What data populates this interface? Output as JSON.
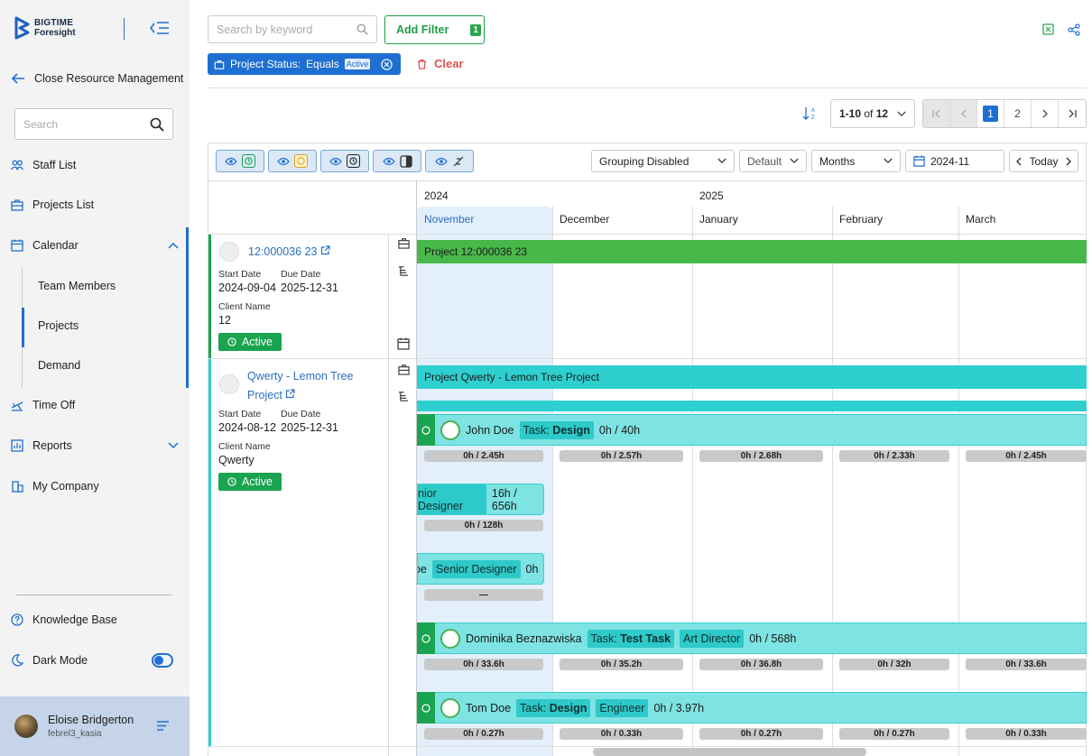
{
  "brand": {
    "line1": "BIGTIME",
    "line2": "Foresight"
  },
  "sidebar": {
    "back_label": "Close Resource Management",
    "search_placeholder": "Search",
    "items": {
      "staff": "Staff List",
      "projects": "Projects List",
      "calendar": "Calendar",
      "team": "Team Members",
      "cal_projects": "Projects",
      "demand": "Demand",
      "timeoff": "Time Off",
      "reports": "Reports",
      "company": "My Company"
    },
    "knowledge": "Knowledge Base",
    "dark_mode": "Dark Mode",
    "user": {
      "name": "Eloise Bridgerton",
      "handle": "febrel3_kasia"
    }
  },
  "toolbar": {
    "search_placeholder": "Search by keyword",
    "add_filter": "Add Filter",
    "filter_count": "1",
    "chip": {
      "field": "Project Status:",
      "op": "Equals",
      "value": "Active"
    },
    "clear": "Clear"
  },
  "pagination": {
    "range_bold": "1-10",
    "of": "of",
    "total": "12",
    "pages": [
      "1",
      "2"
    ]
  },
  "calendar": {
    "grouping": "Grouping Disabled",
    "default": "Default",
    "scale": "Months",
    "date": "2024-11",
    "today": "Today",
    "years": {
      "y2024": "2024",
      "y2025": "2025"
    },
    "months": {
      "nov": "November",
      "dec": "December",
      "jan": "January",
      "feb": "February",
      "mar": "March"
    }
  },
  "projects": [
    {
      "code": "12:000036 23",
      "start_label": "Start Date",
      "start": "2024-09-04",
      "due_label": "Due Date",
      "due": "2025-12-31",
      "client_label": "Client Name",
      "client": "12",
      "status": "Active",
      "bar": "Project 12:000036 23"
    },
    {
      "name1": "Qwerty - Lemon Tree",
      "name2": "Project",
      "start_label": "Start Date",
      "start": "2024-08-12",
      "due_label": "Due Date",
      "due": "2025-12-31",
      "client_label": "Client Name",
      "client": "Qwerty",
      "status": "Active",
      "bar": "Project Qwerty - Lemon Tree Project"
    }
  ],
  "rows": {
    "john": {
      "name": "John Doe",
      "task_prefix": "Task:",
      "task": "Design",
      "hours": "0h / 40h",
      "cells": [
        "0h / 2.45h",
        "0h / 2.57h",
        "0h / 2.68h",
        "0h / 2.33h",
        "0h / 2.45h"
      ]
    },
    "sd1": {
      "role": "nior Designer",
      "hours": "16h / 656h",
      "cell": "0h / 128h"
    },
    "sd2": {
      "name": "oe",
      "role": "Senior Designer",
      "hours": "0h",
      "cell": "—"
    },
    "dom": {
      "name": "Dominika Beznazwiska",
      "task_prefix": "Task:",
      "task": "Test Task",
      "role": "Art Director",
      "hours": "0h / 568h",
      "cells": [
        "0h / 33.6h",
        "0h / 35.2h",
        "0h / 36.8h",
        "0h / 32h",
        "0h / 33.6h"
      ]
    },
    "tom": {
      "name": "Tom Doe",
      "task_prefix": "Task:",
      "task": "Design",
      "role": "Engineer",
      "hours": "0h / 3.97h",
      "cells": [
        "0h / 0.27h",
        "0h / 0.33h",
        "0h / 0.27h",
        "0h / 0.27h",
        "0h / 0.33h"
      ]
    }
  },
  "colors": {
    "accent": "#1e6fd1",
    "green": "#1aa350",
    "teal": "#2ecfcf",
    "current_month": "#e3f0fb"
  }
}
